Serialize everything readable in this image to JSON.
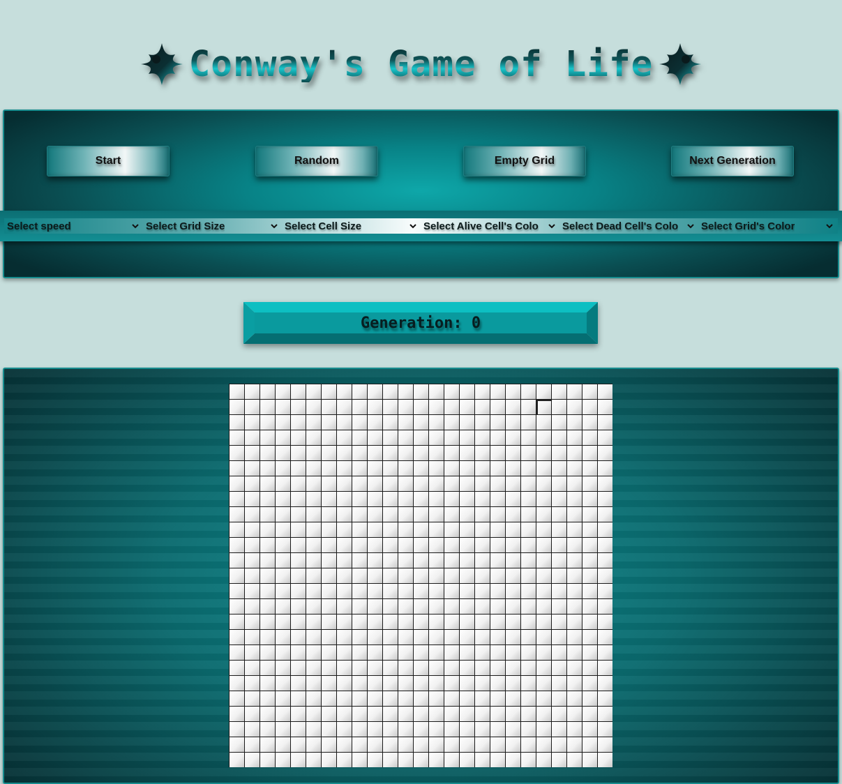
{
  "page": {
    "title": "Conway's Game of Life",
    "title_icon": "star-burst-icon"
  },
  "controls": {
    "buttons": [
      {
        "label": "Start"
      },
      {
        "label": "Random"
      },
      {
        "label": "Empty Grid"
      },
      {
        "label": "Next Generation"
      }
    ],
    "selects": [
      {
        "label": "Select speed"
      },
      {
        "label": "Select Grid Size"
      },
      {
        "label": "Select Cell Size"
      },
      {
        "label": "Select Alive Cell's Colo"
      },
      {
        "label": "Select Dead Cell's Colo"
      },
      {
        "label": "Select Grid's Color"
      }
    ]
  },
  "generation": {
    "text": "Generation: 0"
  },
  "board": {
    "rows": 25,
    "cols": 25,
    "hovered_cell": [
      1,
      20
    ],
    "colors": {
      "dead_cell": "#f2f2f2",
      "grid_line": "#1a1a1a",
      "accent": "#0a8f93",
      "background": "#c6dedc"
    }
  }
}
